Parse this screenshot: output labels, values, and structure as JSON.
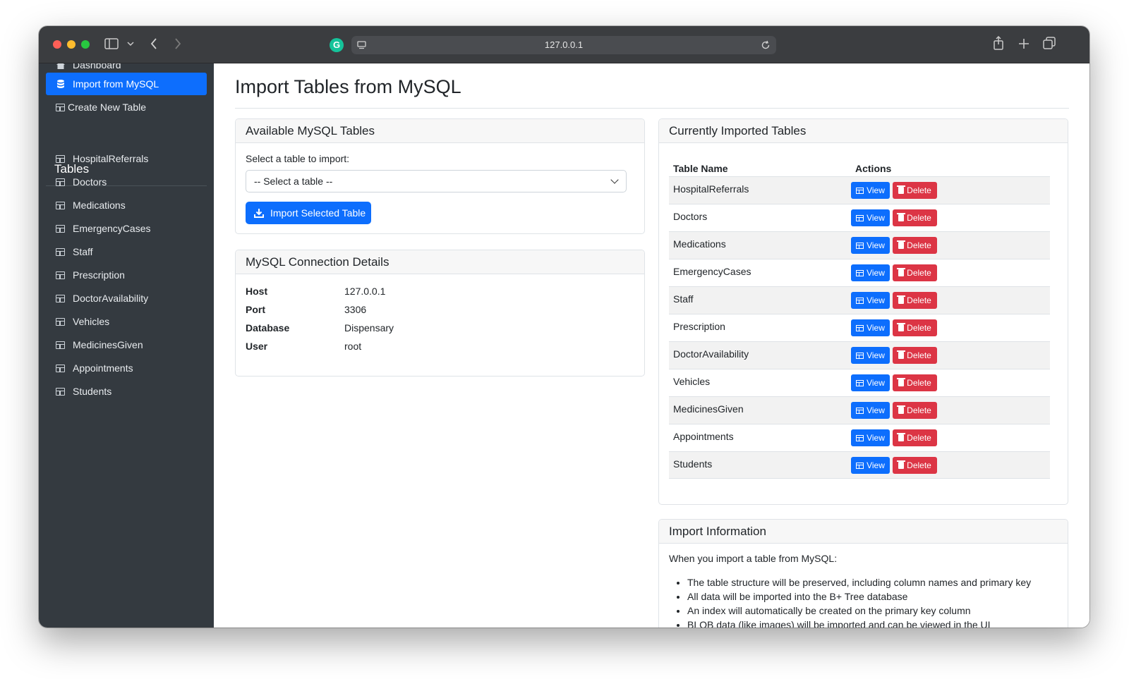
{
  "browser": {
    "url": "127.0.0.1"
  },
  "sidebar": {
    "top_items": [
      {
        "label": "Dashboard",
        "icon": "home-icon"
      },
      {
        "label": "Import from MySQL",
        "icon": "database-icon",
        "active": true
      },
      {
        "label": "Create New Table",
        "icon": "table-icon"
      }
    ],
    "tables_heading": "Tables",
    "tables": [
      "HospitalReferrals",
      "Doctors",
      "Medications",
      "EmergencyCases",
      "Staff",
      "Prescription",
      "DoctorAvailability",
      "Vehicles",
      "MedicinesGiven",
      "Appointments",
      "Students"
    ]
  },
  "main": {
    "title": "Import Tables from MySQL",
    "available": {
      "header": "Available MySQL Tables",
      "select_label": "Select a table to import:",
      "select_value": "-- Select a table --",
      "import_button": "Import Selected Table"
    },
    "connection": {
      "header": "MySQL Connection Details",
      "rows": [
        {
          "key": "Host",
          "value": "127.0.0.1"
        },
        {
          "key": "Port",
          "value": "3306"
        },
        {
          "key": "Database",
          "value": "Dispensary"
        },
        {
          "key": "User",
          "value": "root"
        }
      ]
    },
    "imported": {
      "header": "Currently Imported Tables",
      "col_name": "Table Name",
      "col_actions": "Actions",
      "view_label": "View",
      "delete_label": "Delete",
      "rows": [
        "HospitalReferrals",
        "Doctors",
        "Medications",
        "EmergencyCases",
        "Staff",
        "Prescription",
        "DoctorAvailability",
        "Vehicles",
        "MedicinesGiven",
        "Appointments",
        "Students"
      ]
    },
    "info": {
      "header": "Import Information",
      "intro": "When you import a table from MySQL:",
      "bullets": [
        "The table structure will be preserved, including column names and primary key",
        "All data will be imported into the B+ Tree database",
        "An index will automatically be created on the primary key column",
        "BLOB data (like images) will be imported and can be viewed in the UI"
      ]
    }
  },
  "colors": {
    "sidebar_bg": "#343a40",
    "primary": "#0d6efd",
    "danger": "#dc3545",
    "toolbar": "#3b3d40"
  }
}
